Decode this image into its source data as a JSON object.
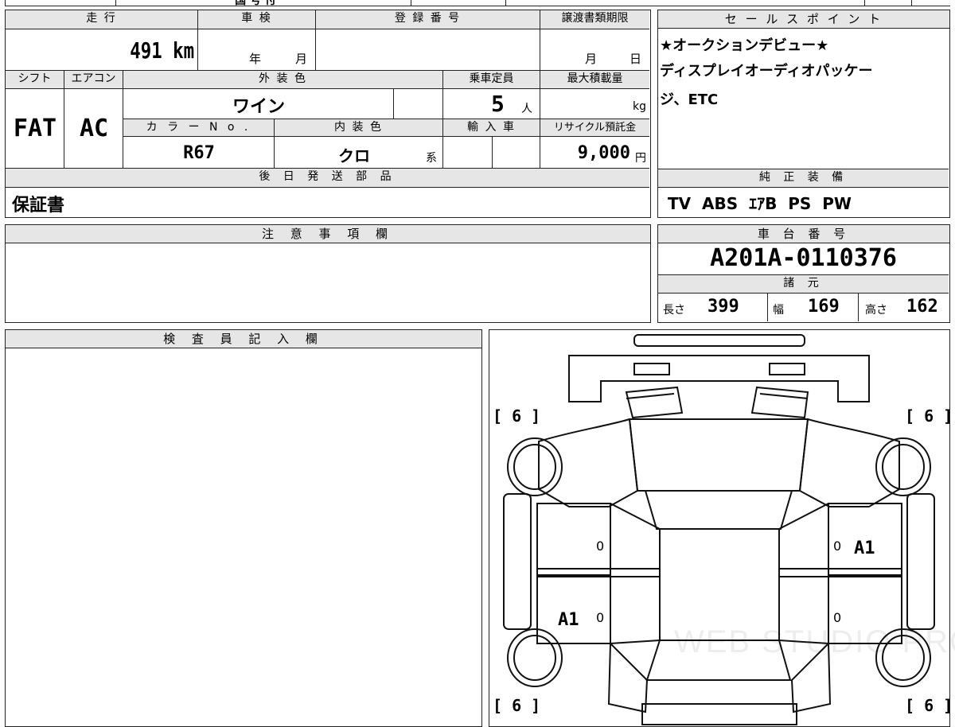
{
  "top_strip": {
    "text": "国 号 付"
  },
  "labels": {
    "mileage": "走 行",
    "shaken": "車 検",
    "reg_number": "登 録 番 号",
    "transfer_deadline": "譲渡書類期限",
    "sales_points": "セ ー ル ス ポ イ ン ト",
    "shift": "シフト",
    "aircon": "エアコン",
    "exterior_color": "外 装 色",
    "capacity": "乗車定員",
    "max_load": "最大積載量",
    "color_no": "カ ラ ー N o .",
    "interior_color": "内 装 色",
    "import": "輸 入 車",
    "recycle": "リサイクル預託金",
    "later_parts": "後 日 発 送 部 品",
    "genuine_equipment": "純 正 装 備",
    "notes": "注 意 事 項 欄",
    "chassis_number": "車 台 番 号",
    "specs": "諸 元",
    "inspector": "検 査 員 記 入 欄"
  },
  "values": {
    "mileage": "491 km",
    "shaken_year": "年",
    "shaken_month": "月",
    "deadline_month": "月",
    "deadline_day": "日",
    "shift": "FAT",
    "aircon": "AC",
    "exterior_color": "ワイン",
    "capacity": "5",
    "capacity_unit": "人",
    "max_load_unit": "kg",
    "color_no": "R67",
    "interior_color": "クロ",
    "interior_suffix": "系",
    "recycle": "9,000",
    "recycle_unit": "円",
    "later_parts": "保証書",
    "genuine_equipment": "TV  ABS  ｴｱB  PS  PW",
    "chassis_number": "A201A-0110376",
    "length_label": "長さ",
    "length": "399",
    "width_label": "幅",
    "width": "169",
    "height_label": "高さ",
    "height": "162"
  },
  "sales_points": {
    "line1": "★オークションデビュー★",
    "line2": "ディスプレイオーディオパッケー",
    "line3": "ジ、ETC"
  },
  "diagram": {
    "tire_tread_fl": "[ 6 ]",
    "tire_tread_fr": "[ 6 ]",
    "tire_tread_rl": "[ 6 ]",
    "tire_tread_rr": "[ 6 ]",
    "damage_right_front": "A1",
    "damage_left_rear": "A1",
    "marks": [
      "0",
      "0",
      "0",
      "0"
    ],
    "watermark": "WEB STUDIO PRO"
  }
}
